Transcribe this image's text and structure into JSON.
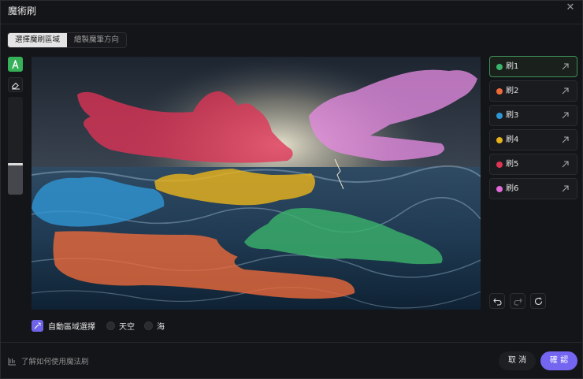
{
  "dialog": {
    "title": "魔術刷"
  },
  "tabs": [
    {
      "label": "選擇魔刷區域",
      "active": true
    },
    {
      "label": "繪製魔筆方向",
      "active": false
    }
  ],
  "brushes": [
    {
      "label": "刷1",
      "color": "#3bb36a",
      "active": true
    },
    {
      "label": "刷2",
      "color": "#ef6a3a",
      "active": false
    },
    {
      "label": "刷3",
      "color": "#2f96d4",
      "active": false
    },
    {
      "label": "刷4",
      "color": "#e6b21c",
      "active": false
    },
    {
      "label": "刷5",
      "color": "#e03356",
      "active": false
    },
    {
      "label": "刷6",
      "color": "#e06ad8",
      "active": false
    }
  ],
  "tools": {
    "brush_icon": "brush-icon",
    "eraser_icon": "eraser-icon",
    "size_level": 0.32
  },
  "history": {
    "undo_icon": "undo-icon",
    "redo_icon": "redo-icon",
    "reset_icon": "reset-icon"
  },
  "auto_select": {
    "label": "自動區域選擇",
    "options": [
      {
        "label": "天空"
      },
      {
        "label": "海"
      }
    ]
  },
  "footer": {
    "help_text": "了解如何使用魔法刷",
    "cancel_label": "取 消",
    "confirm_label": "確 認"
  }
}
